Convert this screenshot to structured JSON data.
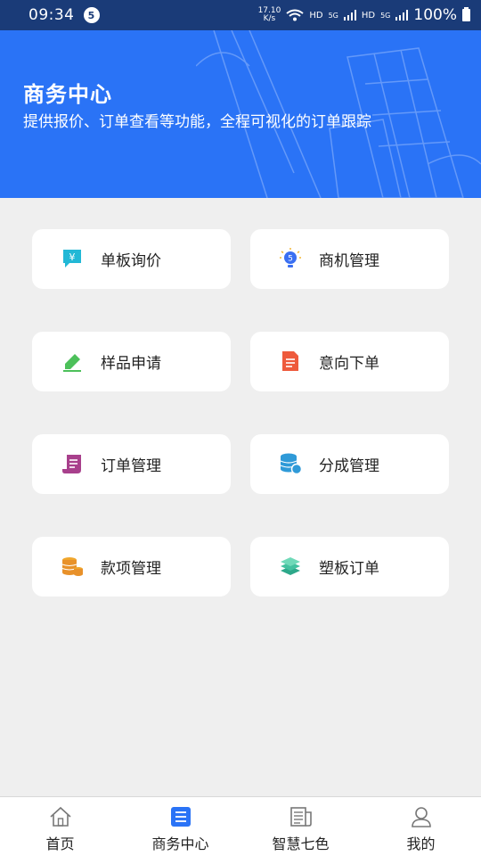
{
  "status_bar": {
    "time": "09:34",
    "notification_count": "5",
    "net_speed_value": "17.10",
    "net_speed_unit": "K/s",
    "hd1": "HD",
    "hd2": "HD",
    "net1": "5G",
    "net2": "5G",
    "battery": "100%"
  },
  "header": {
    "title": "商务中心",
    "subtitle": "提供报价、订单查看等功能，全程可视化的订单跟踪",
    "background_color": "#2a73f6"
  },
  "menu": {
    "items": [
      {
        "label": "单板询价",
        "icon": "quote-icon"
      },
      {
        "label": "商机管理",
        "icon": "lightbulb-icon"
      },
      {
        "label": "样品申请",
        "icon": "pen-icon"
      },
      {
        "label": "意向下单",
        "icon": "document-icon"
      },
      {
        "label": "订单管理",
        "icon": "scroll-icon"
      },
      {
        "label": "分成管理",
        "icon": "database-icon"
      },
      {
        "label": "款项管理",
        "icon": "coins-icon"
      },
      {
        "label": "塑板订单",
        "icon": "layers-icon"
      }
    ]
  },
  "bottom_nav": {
    "items": [
      {
        "label": "首页",
        "icon": "home-icon",
        "active": false
      },
      {
        "label": "商务中心",
        "icon": "list-icon",
        "active": true
      },
      {
        "label": "智慧七色",
        "icon": "news-icon",
        "active": false
      },
      {
        "label": "我的",
        "icon": "user-icon",
        "active": false
      }
    ],
    "active_color": "#2a73f6"
  }
}
